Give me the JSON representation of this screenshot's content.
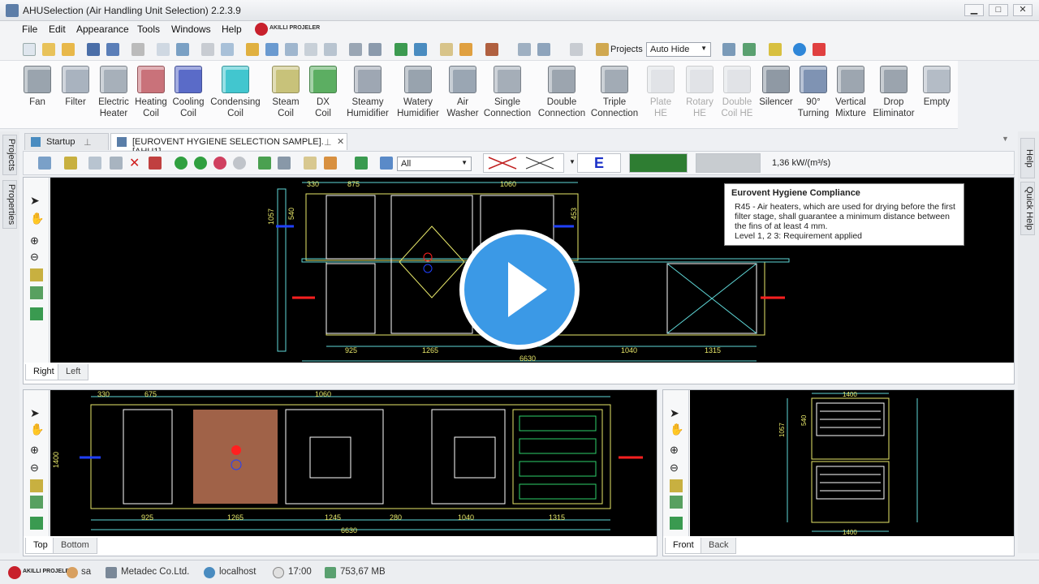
{
  "app": {
    "title": "AHUSelection (Air Handling Unit Selection) 2.2.3.9",
    "brand": "AKILLI PROJELER"
  },
  "window_controls": [
    "▁",
    "□",
    "✕"
  ],
  "menu": [
    "File",
    "Edit",
    "Appearance",
    "Tools",
    "Windows",
    "Help"
  ],
  "toolbar": {
    "projects_label": "Projects",
    "projects_mode": "Auto Hide"
  },
  "ribbon": [
    {
      "label": "Fan",
      "color": "#9aa4ae",
      "enabled": true
    },
    {
      "label": "Filter",
      "color": "#a9b3bf",
      "enabled": true
    },
    {
      "label": "Electric\nHeater",
      "color": "#a7b0ba",
      "enabled": true
    },
    {
      "label": "Heating\nCoil",
      "color": "#c9727a",
      "enabled": true
    },
    {
      "label": "Cooling\nCoil",
      "color": "#5a6bc8",
      "enabled": true
    },
    {
      "label": "Condensing\nCoil",
      "color": "#42c6cf",
      "enabled": true
    },
    {
      "label": "Steam\nCoil",
      "color": "#c8c27a",
      "enabled": true
    },
    {
      "label": "DX\nCoil",
      "color": "#5cae62",
      "enabled": true
    },
    {
      "label": "Steamy\nHumidifier",
      "color": "#9ea7b3",
      "enabled": true
    },
    {
      "label": "Watery\nHumidifier",
      "color": "#98a3ae",
      "enabled": true
    },
    {
      "label": "Air\nWasher",
      "color": "#9aa6b3",
      "enabled": true
    },
    {
      "label": "Single\nConnection",
      "color": "#a5aeb8",
      "enabled": true
    },
    {
      "label": "Double\nConnection",
      "color": "#9ca5af",
      "enabled": true
    },
    {
      "label": "Triple\nConnection",
      "color": "#a2abb5",
      "enabled": true
    },
    {
      "label": "Plate\nHE",
      "color": "#c3c8ce",
      "enabled": false
    },
    {
      "label": "Rotary\nHE",
      "color": "#c3c8ce",
      "enabled": false
    },
    {
      "label": "Double\nCoil HE",
      "color": "#c3c8ce",
      "enabled": false
    },
    {
      "label": "Silencer",
      "color": "#8f99a4",
      "enabled": true
    },
    {
      "label": "90°\nTurning",
      "color": "#7f93b3",
      "enabled": true
    },
    {
      "label": "Vertical\nMixture",
      "color": "#9da6b0",
      "enabled": true
    },
    {
      "label": "Drop\nEliminator",
      "color": "#9ba4ae",
      "enabled": true
    },
    {
      "label": "Empty",
      "color": "#b4bcc6",
      "enabled": true
    }
  ],
  "side_tabs": {
    "left": [
      "Projects",
      "Properties"
    ],
    "right": [
      "Help",
      "Quick Help"
    ]
  },
  "doc_tabs": [
    {
      "label": "Startup",
      "active": false
    },
    {
      "label": "[EUROVENT HYGIENE SELECTION SAMPLE].[AHU1]",
      "active": true
    }
  ],
  "doc_toolbar": {
    "filter": "All",
    "energy_class": "E",
    "airflow": "1,36 kW/(m³/s)"
  },
  "tooltip": {
    "title": "Eurovent Hygiene Compliance",
    "body": "R45 - Air heaters, which are used for drying before the first filter stage, shall guarantee a minimum distance between the fins of at least 4 mm.",
    "level": "Level 1, 2  3: Requirement applied"
  },
  "views": {
    "side": {
      "tabs": [
        "Right",
        "Left"
      ],
      "dims_top": [
        "330",
        "875",
        "1060"
      ],
      "dims_bottom": [
        "925",
        "1265",
        "1040",
        "1315"
      ],
      "total": "6630",
      "heights": [
        "1057",
        "540",
        "453"
      ]
    },
    "top": {
      "tabs": [
        "Top",
        "Bottom"
      ],
      "dims_top": [
        "330",
        "675",
        "1060"
      ],
      "dims_bottom": [
        "925",
        "1265",
        "1245",
        "280",
        "1040",
        "1315"
      ],
      "total": "6630",
      "height": "1400"
    },
    "front": {
      "tabs": [
        "Front",
        "Back"
      ],
      "width": "1400",
      "heights": [
        "1057",
        "540"
      ]
    }
  },
  "status": {
    "user": "sa",
    "company": "Metadec Co.Ltd.",
    "server": "localhost",
    "time": "17:00",
    "memory": "753,67 MB"
  },
  "colors": {
    "accent": "#3b99e6",
    "canvas": "#000000",
    "cad_yellow": "#e8e86a",
    "cad_cyan": "#5fd8d8",
    "cad_red": "#ff2020"
  }
}
